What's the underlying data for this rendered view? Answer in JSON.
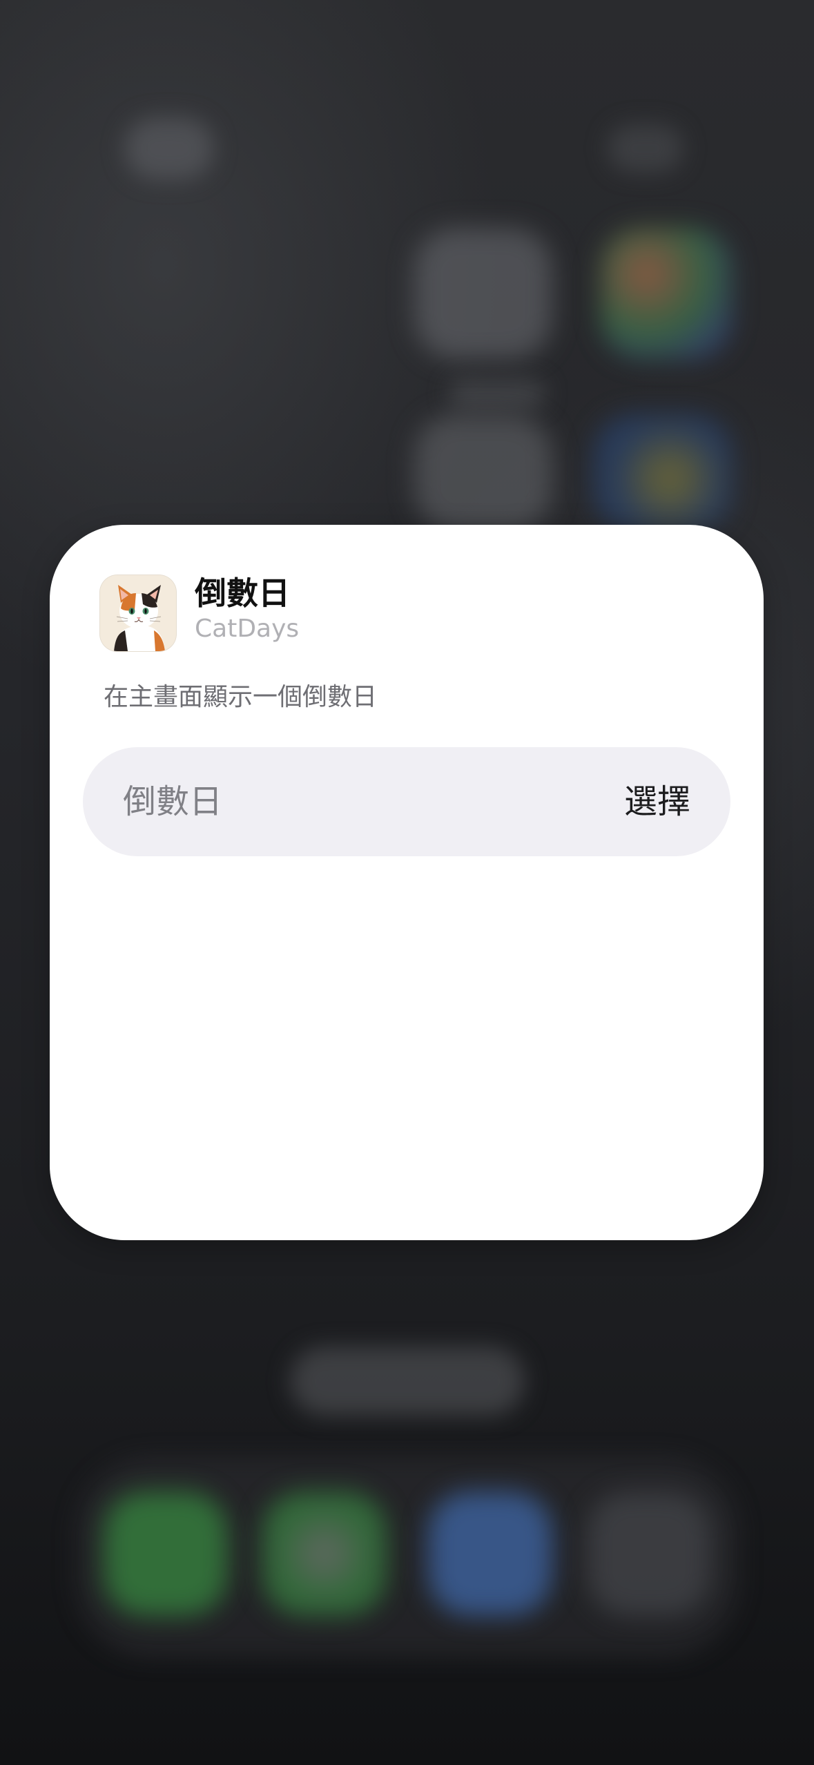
{
  "widget": {
    "title": "倒數日",
    "app_name": "CatDays",
    "description": "在主畫面顯示一個倒數日",
    "icon": "calico-cat-app-icon"
  },
  "parameter": {
    "label": "倒數日",
    "value": "選擇"
  },
  "colors": {
    "card_background": "#ffffff",
    "row_background": "#f0eff4",
    "title_text": "#111111",
    "secondary_text": "#b0b0b4",
    "description_text": "#6e6e73",
    "backdrop": "#1e1f21"
  }
}
